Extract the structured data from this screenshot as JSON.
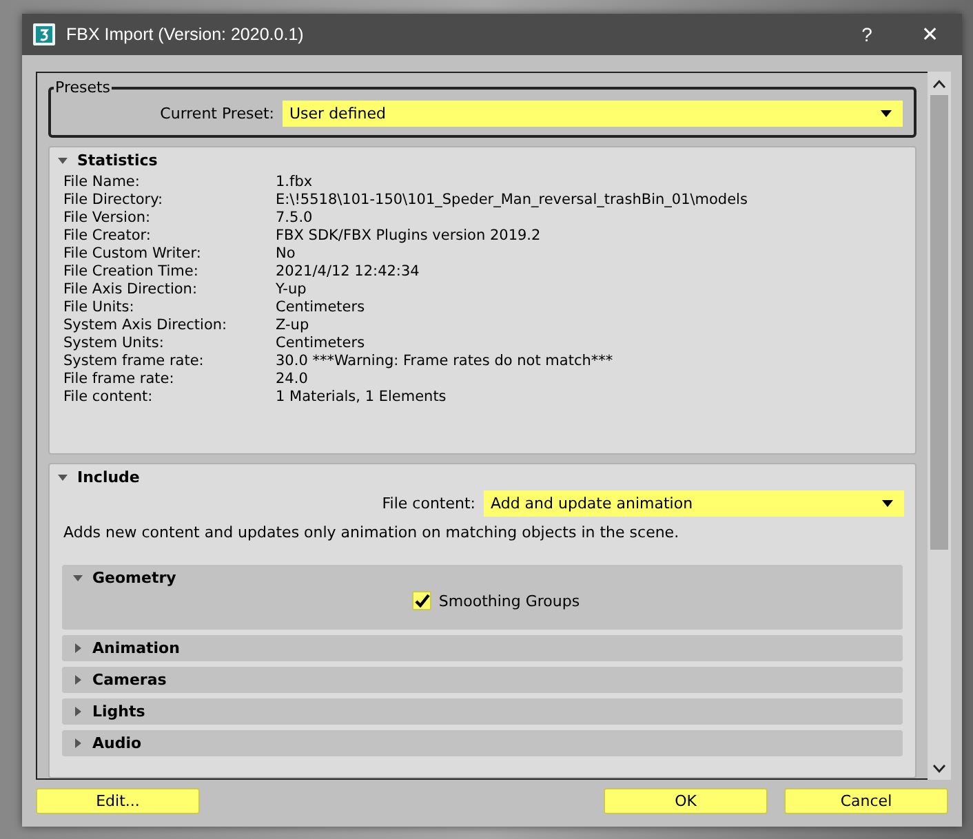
{
  "window": {
    "title": "FBX Import (Version: 2020.0.1)",
    "help": "?",
    "close": "✕"
  },
  "presets": {
    "title": "Presets",
    "label": "Current Preset:",
    "value": "User defined"
  },
  "statistics": {
    "title": "Statistics",
    "expanded": true,
    "rows": [
      {
        "label": "File Name:",
        "value": "1.fbx"
      },
      {
        "label": "File Directory:",
        "value": "E:\\!5518\\101-150\\101_Speder_Man_reversal_trashBin_01\\models"
      },
      {
        "label": "File Version:",
        "value": "7.5.0"
      },
      {
        "label": "File Creator:",
        "value": "FBX SDK/FBX Plugins version 2019.2"
      },
      {
        "label": "File Custom Writer:",
        "value": "No"
      },
      {
        "label": "File Creation Time:",
        "value": "2021/4/12  12:42:34"
      },
      {
        "label": "File Axis Direction:",
        "value": "Y-up"
      },
      {
        "label": "File Units:",
        "value": "Centimeters"
      },
      {
        "label": "System Axis Direction:",
        "value": "Z-up"
      },
      {
        "label": "System Units:",
        "value": "Centimeters"
      },
      {
        "label": "System frame rate:",
        "value": "30.0  ***Warning: Frame rates do not match***"
      },
      {
        "label": "File frame rate:",
        "value": "24.0"
      },
      {
        "label": "File content:",
        "value": "1 Materials,    1 Elements"
      }
    ]
  },
  "include": {
    "title": "Include",
    "expanded": true,
    "label": "File content:",
    "value": "Add and update animation",
    "description": "Adds new content and updates only animation on matching objects in the scene.",
    "rollouts": [
      {
        "title": "Geometry",
        "expanded": true,
        "options": [
          {
            "label": "Smoothing Groups",
            "checked": true
          }
        ]
      },
      {
        "title": "Animation",
        "expanded": false
      },
      {
        "title": "Cameras",
        "expanded": false
      },
      {
        "title": "Lights",
        "expanded": false
      },
      {
        "title": "Audio",
        "expanded": false
      }
    ]
  },
  "buttons": {
    "left": [
      "Edit..."
    ],
    "right": [
      "OK",
      "Cancel"
    ]
  }
}
